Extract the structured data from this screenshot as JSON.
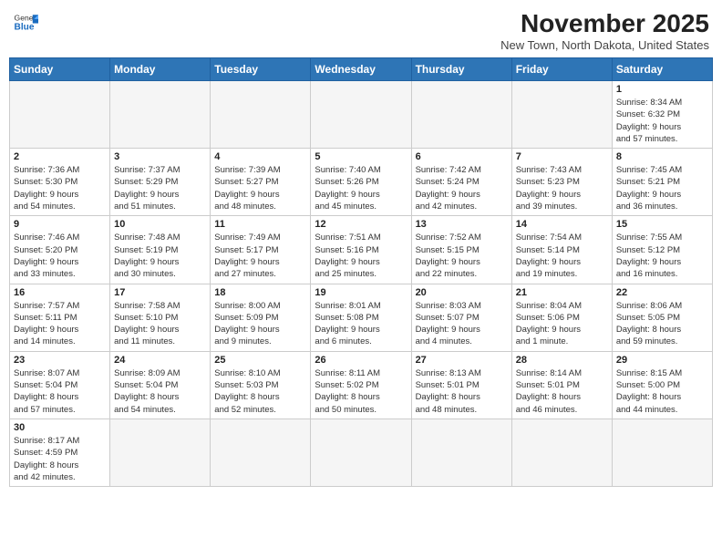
{
  "header": {
    "logo_general": "General",
    "logo_blue": "Blue",
    "month_title": "November 2025",
    "location": "New Town, North Dakota, United States"
  },
  "weekdays": [
    "Sunday",
    "Monday",
    "Tuesday",
    "Wednesday",
    "Thursday",
    "Friday",
    "Saturday"
  ],
  "weeks": [
    [
      {
        "day": "",
        "info": ""
      },
      {
        "day": "",
        "info": ""
      },
      {
        "day": "",
        "info": ""
      },
      {
        "day": "",
        "info": ""
      },
      {
        "day": "",
        "info": ""
      },
      {
        "day": "",
        "info": ""
      },
      {
        "day": "1",
        "info": "Sunrise: 8:34 AM\nSunset: 6:32 PM\nDaylight: 9 hours\nand 57 minutes."
      }
    ],
    [
      {
        "day": "2",
        "info": "Sunrise: 7:36 AM\nSunset: 5:30 PM\nDaylight: 9 hours\nand 54 minutes."
      },
      {
        "day": "3",
        "info": "Sunrise: 7:37 AM\nSunset: 5:29 PM\nDaylight: 9 hours\nand 51 minutes."
      },
      {
        "day": "4",
        "info": "Sunrise: 7:39 AM\nSunset: 5:27 PM\nDaylight: 9 hours\nand 48 minutes."
      },
      {
        "day": "5",
        "info": "Sunrise: 7:40 AM\nSunset: 5:26 PM\nDaylight: 9 hours\nand 45 minutes."
      },
      {
        "day": "6",
        "info": "Sunrise: 7:42 AM\nSunset: 5:24 PM\nDaylight: 9 hours\nand 42 minutes."
      },
      {
        "day": "7",
        "info": "Sunrise: 7:43 AM\nSunset: 5:23 PM\nDaylight: 9 hours\nand 39 minutes."
      },
      {
        "day": "8",
        "info": "Sunrise: 7:45 AM\nSunset: 5:21 PM\nDaylight: 9 hours\nand 36 minutes."
      }
    ],
    [
      {
        "day": "9",
        "info": "Sunrise: 7:46 AM\nSunset: 5:20 PM\nDaylight: 9 hours\nand 33 minutes."
      },
      {
        "day": "10",
        "info": "Sunrise: 7:48 AM\nSunset: 5:19 PM\nDaylight: 9 hours\nand 30 minutes."
      },
      {
        "day": "11",
        "info": "Sunrise: 7:49 AM\nSunset: 5:17 PM\nDaylight: 9 hours\nand 27 minutes."
      },
      {
        "day": "12",
        "info": "Sunrise: 7:51 AM\nSunset: 5:16 PM\nDaylight: 9 hours\nand 25 minutes."
      },
      {
        "day": "13",
        "info": "Sunrise: 7:52 AM\nSunset: 5:15 PM\nDaylight: 9 hours\nand 22 minutes."
      },
      {
        "day": "14",
        "info": "Sunrise: 7:54 AM\nSunset: 5:14 PM\nDaylight: 9 hours\nand 19 minutes."
      },
      {
        "day": "15",
        "info": "Sunrise: 7:55 AM\nSunset: 5:12 PM\nDaylight: 9 hours\nand 16 minutes."
      }
    ],
    [
      {
        "day": "16",
        "info": "Sunrise: 7:57 AM\nSunset: 5:11 PM\nDaylight: 9 hours\nand 14 minutes."
      },
      {
        "day": "17",
        "info": "Sunrise: 7:58 AM\nSunset: 5:10 PM\nDaylight: 9 hours\nand 11 minutes."
      },
      {
        "day": "18",
        "info": "Sunrise: 8:00 AM\nSunset: 5:09 PM\nDaylight: 9 hours\nand 9 minutes."
      },
      {
        "day": "19",
        "info": "Sunrise: 8:01 AM\nSunset: 5:08 PM\nDaylight: 9 hours\nand 6 minutes."
      },
      {
        "day": "20",
        "info": "Sunrise: 8:03 AM\nSunset: 5:07 PM\nDaylight: 9 hours\nand 4 minutes."
      },
      {
        "day": "21",
        "info": "Sunrise: 8:04 AM\nSunset: 5:06 PM\nDaylight: 9 hours\nand 1 minute."
      },
      {
        "day": "22",
        "info": "Sunrise: 8:06 AM\nSunset: 5:05 PM\nDaylight: 8 hours\nand 59 minutes."
      }
    ],
    [
      {
        "day": "23",
        "info": "Sunrise: 8:07 AM\nSunset: 5:04 PM\nDaylight: 8 hours\nand 57 minutes."
      },
      {
        "day": "24",
        "info": "Sunrise: 8:09 AM\nSunset: 5:04 PM\nDaylight: 8 hours\nand 54 minutes."
      },
      {
        "day": "25",
        "info": "Sunrise: 8:10 AM\nSunset: 5:03 PM\nDaylight: 8 hours\nand 52 minutes."
      },
      {
        "day": "26",
        "info": "Sunrise: 8:11 AM\nSunset: 5:02 PM\nDaylight: 8 hours\nand 50 minutes."
      },
      {
        "day": "27",
        "info": "Sunrise: 8:13 AM\nSunset: 5:01 PM\nDaylight: 8 hours\nand 48 minutes."
      },
      {
        "day": "28",
        "info": "Sunrise: 8:14 AM\nSunset: 5:01 PM\nDaylight: 8 hours\nand 46 minutes."
      },
      {
        "day": "29",
        "info": "Sunrise: 8:15 AM\nSunset: 5:00 PM\nDaylight: 8 hours\nand 44 minutes."
      }
    ],
    [
      {
        "day": "30",
        "info": "Sunrise: 8:17 AM\nSunset: 4:59 PM\nDaylight: 8 hours\nand 42 minutes."
      },
      {
        "day": "",
        "info": ""
      },
      {
        "day": "",
        "info": ""
      },
      {
        "day": "",
        "info": ""
      },
      {
        "day": "",
        "info": ""
      },
      {
        "day": "",
        "info": ""
      },
      {
        "day": "",
        "info": ""
      }
    ]
  ]
}
